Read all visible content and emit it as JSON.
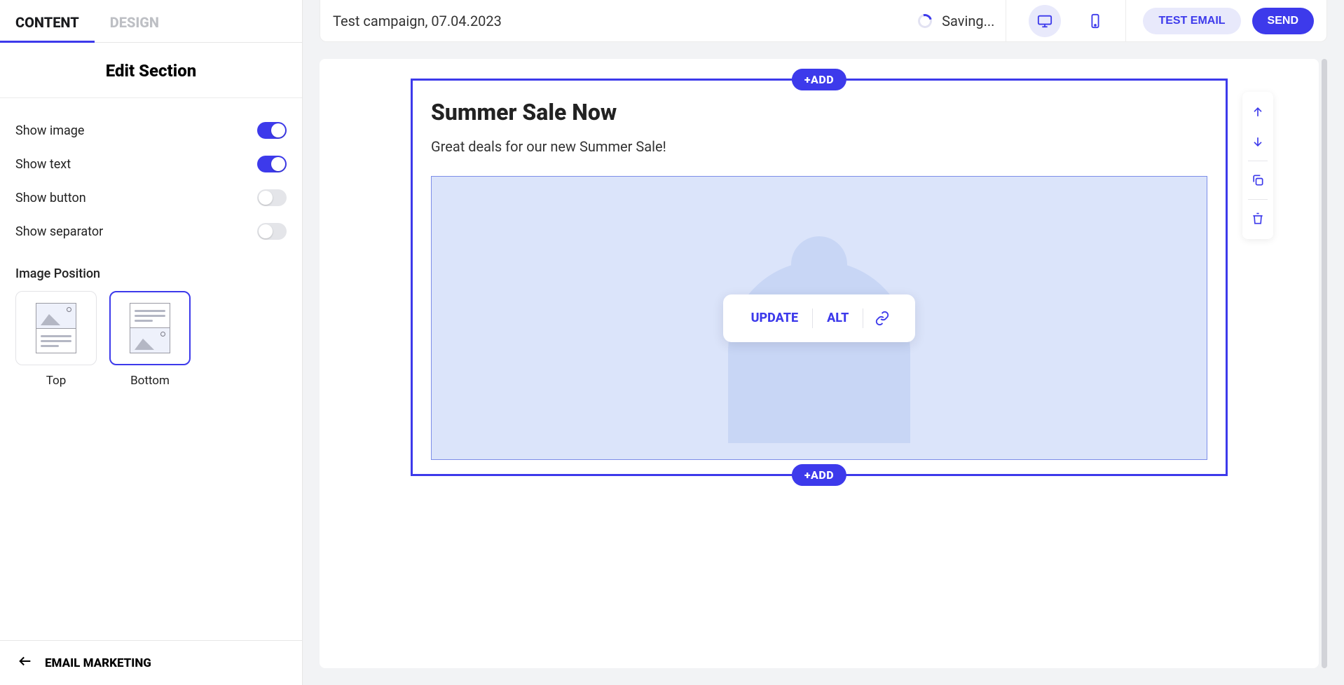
{
  "sidebar": {
    "tabs": {
      "content": "CONTENT",
      "design": "DESIGN"
    },
    "section_title": "Edit Section",
    "toggles": {
      "show_image": {
        "label": "Show image",
        "on": true
      },
      "show_text": {
        "label": "Show text",
        "on": true
      },
      "show_button": {
        "label": "Show button",
        "on": false
      },
      "show_separator": {
        "label": "Show separator",
        "on": false
      }
    },
    "image_position": {
      "label": "Image Position",
      "options": {
        "top": "Top",
        "bottom": "Bottom"
      },
      "selected": "bottom"
    },
    "back_label": "EMAIL MARKETING"
  },
  "topbar": {
    "campaign_title": "Test campaign, 07.04.2023",
    "saving": "Saving...",
    "test_email": "TEST EMAIL",
    "send": "SEND"
  },
  "canvas": {
    "add_label": "+ADD",
    "heading": "Summer Sale Now",
    "text": "Great deals for our new Summer Sale!",
    "image_toolbar": {
      "update": "UPDATE",
      "alt": "ALT"
    }
  }
}
